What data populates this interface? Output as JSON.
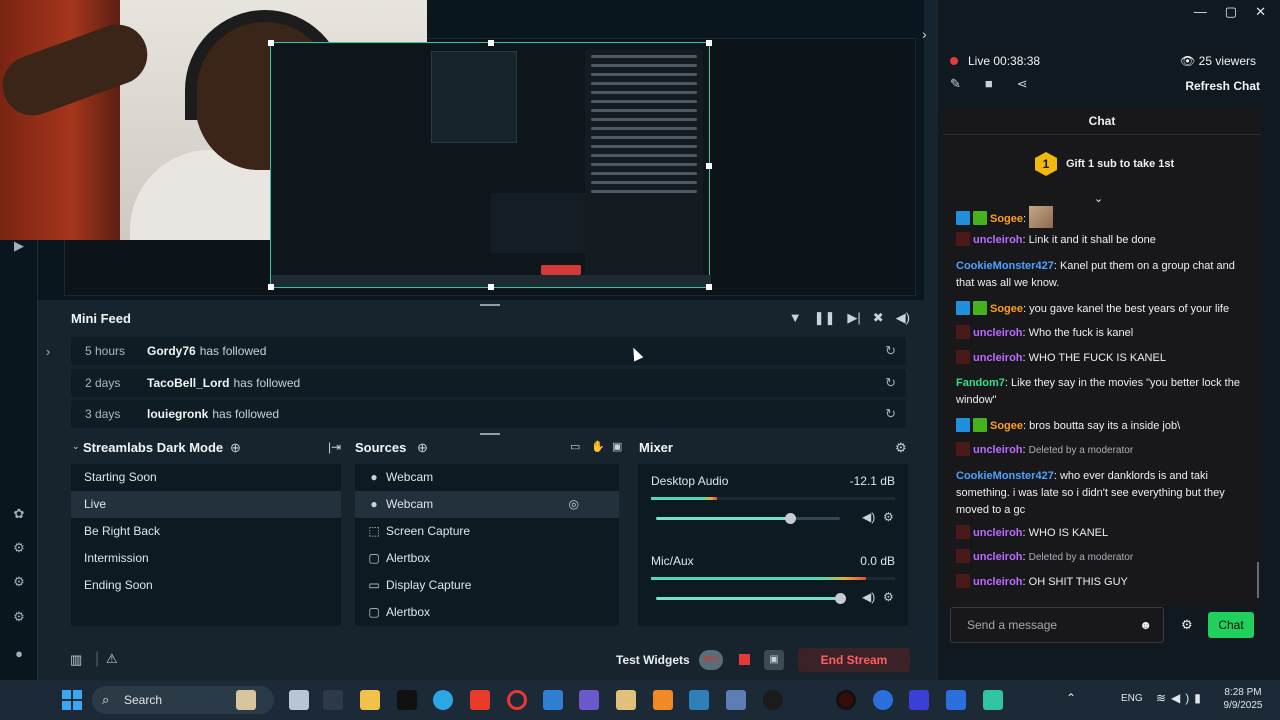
{
  "minifeed": {
    "title": "Mini Feed",
    "items": [
      {
        "time": "5 hours",
        "user": "Gordy76",
        "action": "has followed"
      },
      {
        "time": "2 days",
        "user": "TacoBell_Lord",
        "action": "has followed"
      },
      {
        "time": "3 days",
        "user": "louiegronk",
        "action": "has followed"
      }
    ]
  },
  "scenes": {
    "title": "Streamlabs Dark Mode",
    "items": [
      "Starting Soon",
      "Live",
      "Be Right Back",
      "Intermission",
      "Ending Soon"
    ],
    "active": "Live"
  },
  "sources": {
    "title": "Sources",
    "items": [
      {
        "label": "Webcam",
        "icon": "user-icon"
      },
      {
        "label": "Webcam",
        "icon": "user-icon"
      },
      {
        "label": "Screen Capture",
        "icon": "screen-capture-icon"
      },
      {
        "label": "Alertbox",
        "icon": "alertbox-icon"
      },
      {
        "label": "Display Capture",
        "icon": "monitor-icon"
      },
      {
        "label": "Alertbox",
        "icon": "alertbox-icon"
      }
    ]
  },
  "mixer": {
    "title": "Mixer",
    "channels": [
      {
        "name": "Desktop Audio",
        "db": "-12.1 dB",
        "level": 0.73
      },
      {
        "name": "Mic/Aux",
        "db": "0.0 dB",
        "level": 1.0
      }
    ]
  },
  "status": {
    "test_widgets": "Test Widgets",
    "rec": "REC",
    "end_stream": "End Stream"
  },
  "chat": {
    "live_label": "Live",
    "live_time": "00:38:38",
    "viewers": "25 viewers",
    "refresh": "Refresh Chat",
    "title": "Chat",
    "gift_count": "1",
    "gift_text": "Gift 1 sub to take 1st",
    "messages": [
      {
        "user": "Sogee",
        "text": "",
        "color": "#ff9f1c",
        "badges": [
          "vip",
          "sub"
        ],
        "emote": true
      },
      {
        "user": "uncleiroh",
        "text": "Link it and it shall be done",
        "color": "#b96bff",
        "badges": [
          "red"
        ]
      },
      {
        "user": "CookieMonster427",
        "text": "Kanel put them on a group chat and that was all we know.",
        "color": "#4aa3ff",
        "badges": []
      },
      {
        "user": "Sogee",
        "text": "you gave kanel the best years of your life",
        "color": "#ff9f1c",
        "badges": [
          "vip",
          "sub"
        ]
      },
      {
        "user": "uncleiroh",
        "text": "Who the fuck is kanel",
        "color": "#b96bff",
        "badges": [
          "red"
        ]
      },
      {
        "user": "uncleiroh",
        "text": "WHO THE FUCK IS KANEL",
        "color": "#b96bff",
        "badges": [
          "red"
        ]
      },
      {
        "user": "Fandom7",
        "text": "Like they say in the movies \"you better lock the window\"",
        "color": "#2ee08a",
        "badges": []
      },
      {
        "user": "Sogee",
        "text": "bros boutta say its a inside job\\",
        "color": "#ff9f1c",
        "badges": [
          "vip",
          "sub"
        ]
      },
      {
        "user": "uncleiroh",
        "text": "Deleted by a moderator",
        "color": "#b96bff",
        "badges": [
          "red"
        ],
        "deleted": true
      },
      {
        "user": "CookieMonster427",
        "text": "who ever danklords is and taki something. i was late so i didn't see everything but they moved to a gc",
        "color": "#4aa3ff",
        "badges": []
      },
      {
        "user": "uncleiroh",
        "text": "WHO IS KANEL",
        "color": "#b96bff",
        "badges": [
          "red"
        ]
      },
      {
        "user": "uncleiroh",
        "text": "Deleted by a moderator",
        "color": "#b96bff",
        "badges": [
          "red"
        ],
        "deleted": true
      },
      {
        "user": "uncleiroh",
        "text": "OH SHIT THIS GUY",
        "color": "#b96bff",
        "badges": [
          "red"
        ]
      }
    ],
    "input_placeholder": "Send a message",
    "send_label": "Chat"
  },
  "taskbar": {
    "search": "Search",
    "lang": "ENG",
    "time": "8:28 PM",
    "date": "9/9/2025"
  },
  "colors": {
    "accent": "#31c3a2",
    "live": "#e33b3b",
    "chat_send": "#1fd05d"
  }
}
